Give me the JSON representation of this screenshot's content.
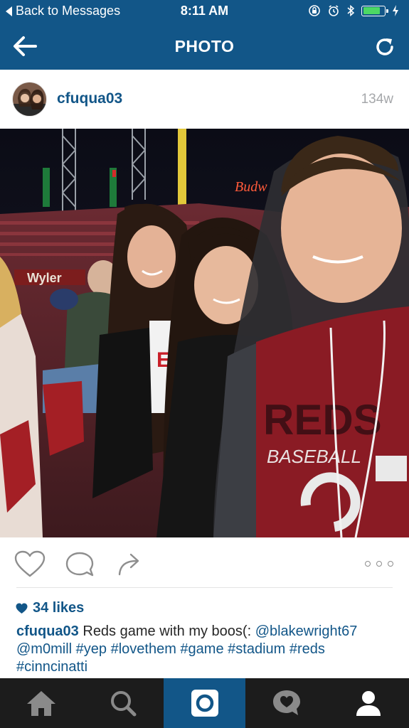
{
  "status_bar": {
    "back_label": "Back to Messages",
    "time": "8:11 AM",
    "battery_level": 0.8
  },
  "nav": {
    "title": "PHOTO",
    "back_icon": "arrow-left-icon",
    "refresh_icon": "refresh-icon"
  },
  "post": {
    "username": "cfuqua03",
    "timestamp": "134w",
    "photo_signs": {
      "wyler": "Wyler",
      "budweiser": "Budw"
    },
    "shirt": {
      "text_top": "REDS",
      "text_mid": "BASEBALL",
      "logo": "C",
      "jersey_letter": "E"
    }
  },
  "actions": {
    "like_icon": "heart-outline-icon",
    "comment_icon": "comment-bubble-icon",
    "share_icon": "share-arrow-icon",
    "more_icon": "more-dots-icon"
  },
  "likes": {
    "label": "34 likes"
  },
  "caption": {
    "username": "cfuqua03",
    "text": " Reds game with my boos(: ",
    "mentions": [
      "@blakewright67",
      "@m0mill"
    ],
    "hashtags": [
      "#yep",
      "#lovethem",
      "#game",
      "#stadium",
      "#reds",
      "#cinncinatti"
    ]
  },
  "tabbar": {
    "items": [
      {
        "name": "home",
        "icon": "home-icon"
      },
      {
        "name": "search",
        "icon": "search-icon"
      },
      {
        "name": "camera",
        "icon": "camera-icon",
        "active": true
      },
      {
        "name": "activity",
        "icon": "heart-bubble-icon"
      },
      {
        "name": "profile",
        "icon": "profile-icon"
      }
    ]
  },
  "colors": {
    "brand_blue": "#125688",
    "tabbar_bg": "#1c1c1c",
    "link_blue": "#125688",
    "muted_gray": "#a5a7aa"
  }
}
